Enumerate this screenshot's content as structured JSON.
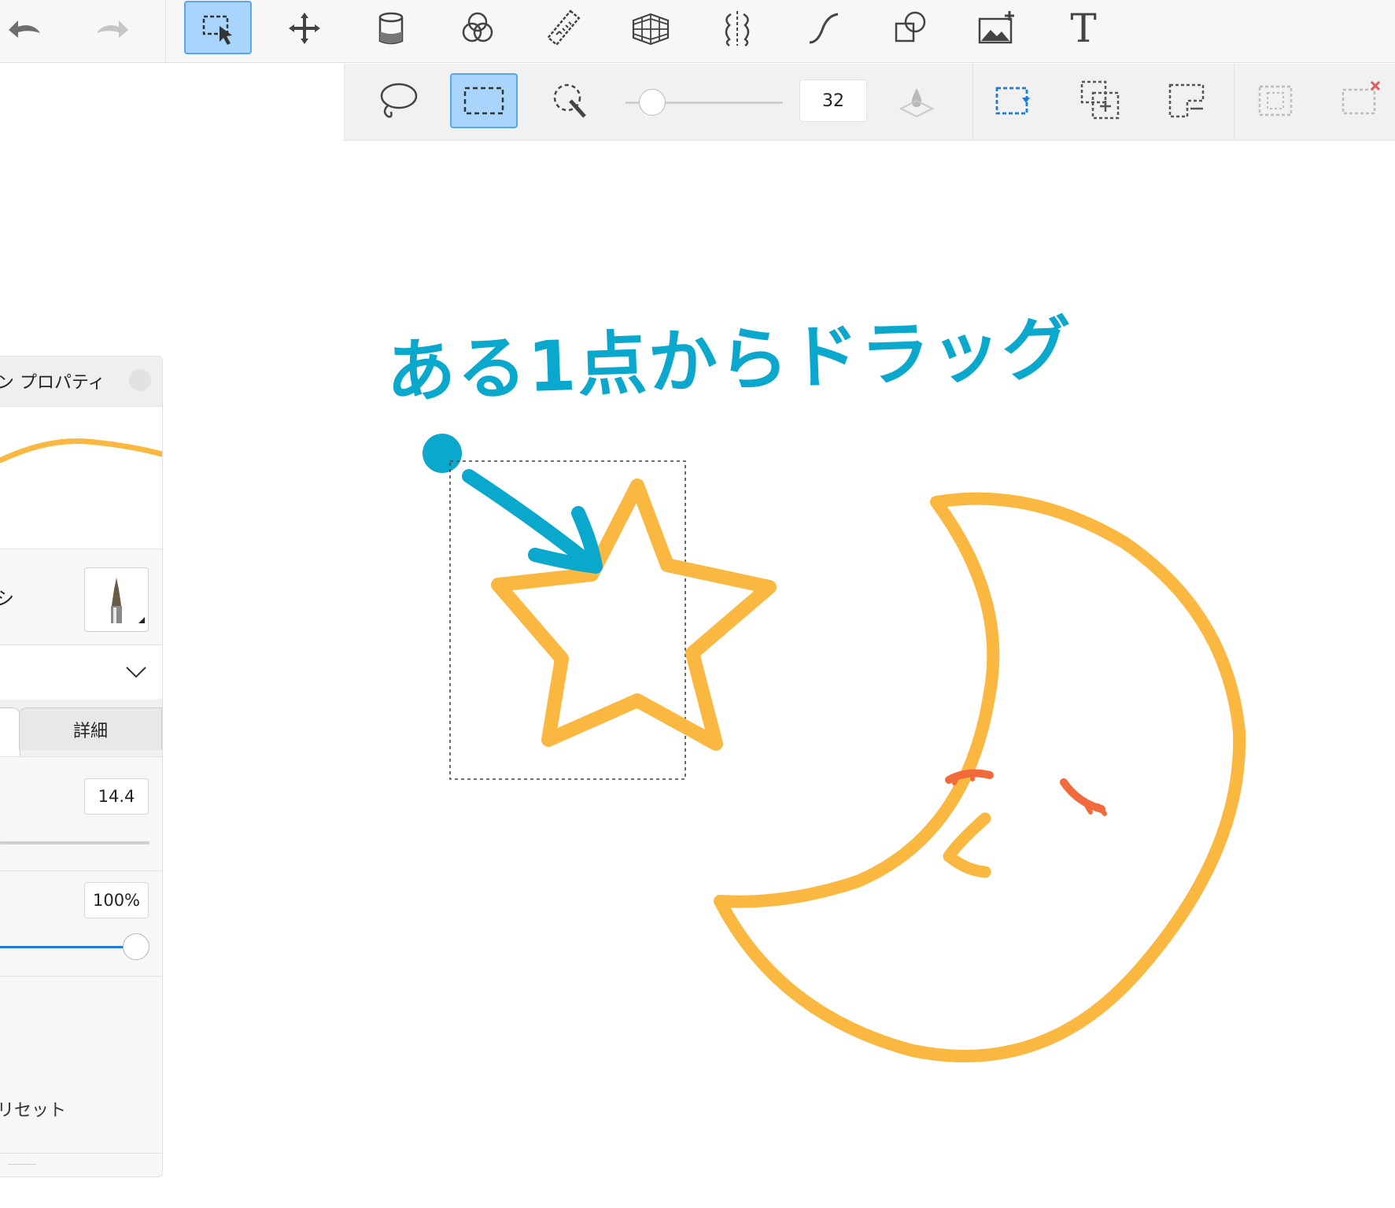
{
  "toolbar": {
    "tools": [
      {
        "name": "undo-icon"
      },
      {
        "name": "redo-icon"
      },
      {
        "name": "selection-tool-icon",
        "active": true
      },
      {
        "name": "move-icon"
      },
      {
        "name": "fill-bucket-icon"
      },
      {
        "name": "blend-circles-icon"
      },
      {
        "name": "ruler-icon"
      },
      {
        "name": "perspective-grid-icon"
      },
      {
        "name": "symmetry-icon"
      },
      {
        "name": "curve-icon"
      },
      {
        "name": "shape-icon"
      },
      {
        "name": "add-image-icon"
      },
      {
        "name": "text-tool-icon",
        "glyph": "T"
      }
    ]
  },
  "selection_options": {
    "modes": [
      {
        "name": "lasso-select-icon"
      },
      {
        "name": "rectangle-select-icon",
        "active": true
      },
      {
        "name": "magic-wand-icon"
      }
    ],
    "brush_size": "32",
    "brush_size_level": 0.18,
    "actions": [
      {
        "name": "select-replace-icon"
      },
      {
        "name": "select-add-icon"
      },
      {
        "name": "select-subtract-icon"
      },
      {
        "name": "select-invert-icon"
      },
      {
        "name": "select-clear-icon"
      }
    ]
  },
  "brush_panel": {
    "title": "ン プロパティ",
    "brush_label": "シ",
    "tab_detail": "詳細",
    "size_value": "14.4",
    "opacity_value": "100%",
    "opacity_level": 1.0,
    "reset_label": "リセット"
  },
  "canvas": {
    "handwritten_text": "ある1点からドラッグ",
    "colors": {
      "annotation": "#0aa8cc",
      "shape_stroke": "#fbb840",
      "accent": "#f26a3c"
    }
  }
}
